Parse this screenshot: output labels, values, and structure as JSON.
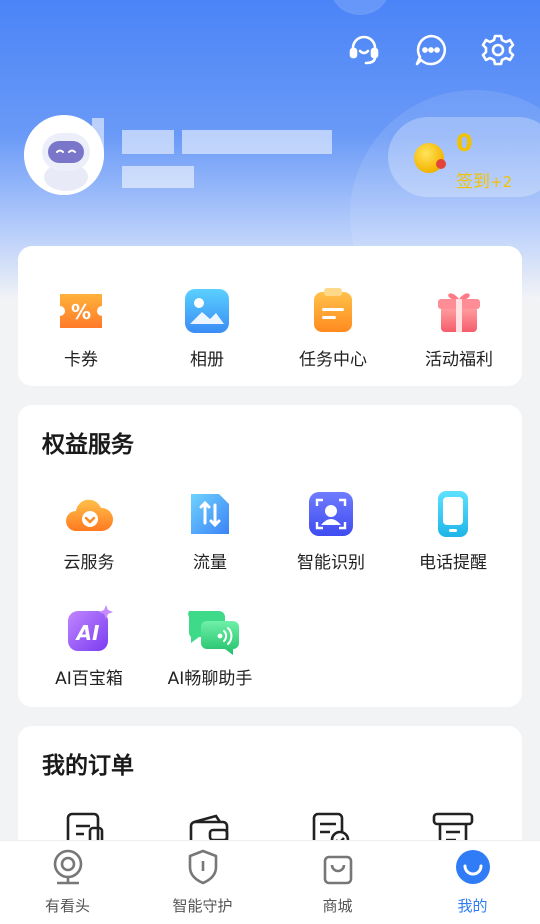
{
  "header": {
    "user": {
      "name": "",
      "sub": ""
    },
    "sign": {
      "count": "0",
      "label": "签到",
      "bonus": "+2"
    },
    "icons": [
      "headset-icon",
      "message-icon",
      "settings-icon"
    ]
  },
  "quick": {
    "items": [
      {
        "label": "卡券",
        "icon": "coupon-icon"
      },
      {
        "label": "相册",
        "icon": "album-icon"
      },
      {
        "label": "任务中心",
        "icon": "task-center-icon"
      },
      {
        "label": "活动福利",
        "icon": "gift-icon"
      }
    ]
  },
  "benefits": {
    "title": "权益服务",
    "items": [
      {
        "label": "云服务",
        "icon": "cloud-service-icon"
      },
      {
        "label": "流量",
        "icon": "data-traffic-icon"
      },
      {
        "label": "智能识别",
        "icon": "face-recognition-icon"
      },
      {
        "label": "电话提醒",
        "icon": "phone-reminder-icon"
      },
      {
        "label": "AI百宝箱",
        "icon": "ai-toolbox-icon"
      },
      {
        "label": "AI畅聊助手",
        "icon": "ai-chat-assistant-icon"
      }
    ]
  },
  "orders": {
    "title": "我的订单",
    "icons": [
      "order-pending-icon",
      "order-wallet-icon",
      "order-completed-icon",
      "order-receipt-icon"
    ]
  },
  "tabbar": {
    "items": [
      {
        "label": "有看头",
        "icon": "camera-icon"
      },
      {
        "label": "智能守护",
        "icon": "shield-icon"
      },
      {
        "label": "商城",
        "icon": "shopping-bag-icon"
      },
      {
        "label": "我的",
        "icon": "profile-icon",
        "active": true
      }
    ]
  },
  "colors": {
    "brand": "#2f7cf6",
    "hero_top": "#4b84f7",
    "coin_text": "#f2c200"
  }
}
